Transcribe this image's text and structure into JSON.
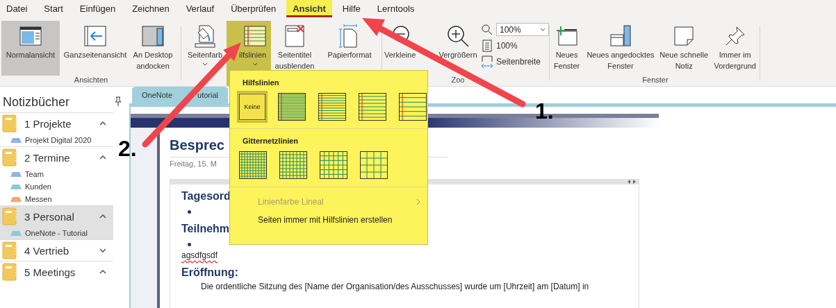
{
  "menu_tabs": [
    {
      "label": "Datei",
      "selected": false
    },
    {
      "label": "Start",
      "selected": false
    },
    {
      "label": "Einfügen",
      "selected": false
    },
    {
      "label": "Zeichnen",
      "selected": false
    },
    {
      "label": "Verlauf",
      "selected": false
    },
    {
      "label": "Überprüfen",
      "selected": false
    },
    {
      "label": "Ansicht",
      "selected": true
    },
    {
      "label": "Hilfe",
      "selected": false
    },
    {
      "label": "Lerntools",
      "selected": false
    }
  ],
  "ribbon_groups": [
    {
      "label": "Ansichten",
      "buttons": [
        {
          "label": "Normalansicht",
          "selected": true,
          "highlighted": false
        },
        {
          "label": "Ganzseitenansicht",
          "selected": false,
          "highlighted": false
        },
        {
          "label": "An Desktop andocken",
          "selected": false,
          "highlighted": false
        }
      ]
    },
    {
      "buttons": [
        {
          "label": "Seitenfarb",
          "caret": true,
          "selected": false,
          "highlighted": false
        },
        {
          "label": "ilfslinien",
          "caret": true,
          "selected": true,
          "highlighted": true
        },
        {
          "label": "Seitentitel ausblenden",
          "selected": false,
          "highlighted": false
        },
        {
          "label": "Papierformat",
          "selected": false,
          "highlighted": false
        }
      ]
    },
    {
      "label": "Zoo",
      "buttons": [
        {
          "label": "Verkleine",
          "selected": false,
          "highlighted": false
        },
        {
          "label": "Vergrößern",
          "selected": false,
          "highlighted": false
        }
      ],
      "small_buttons": [
        {
          "kind": "combo",
          "value": "100%"
        },
        {
          "kind": "button",
          "label": "100%"
        },
        {
          "kind": "button",
          "label": "Seitenbreite"
        }
      ]
    },
    {
      "label": "Fenster",
      "buttons": [
        {
          "label": "Neues Fenster",
          "selected": false,
          "highlighted": false
        },
        {
          "label": "Neues angedocktes Fenster",
          "selected": false,
          "highlighted": false
        },
        {
          "label": "Neue schnelle Notiz",
          "selected": false,
          "highlighted": false
        },
        {
          "label": "Immer im Vordergrund",
          "selected": false,
          "highlighted": false
        }
      ]
    }
  ],
  "sidebar": {
    "title": "Notizbücher",
    "notebooks": [
      {
        "name": "1 Projekte",
        "expanded": true,
        "selected": false,
        "sections": [
          {
            "name": "Projekt Digital 2020",
            "color": "#8fb4e3"
          }
        ]
      },
      {
        "name": "2 Termine",
        "expanded": true,
        "selected": false,
        "sections": [
          {
            "name": "Team",
            "color": "#8fb4e3"
          },
          {
            "name": "Kunden",
            "color": "#8ccad8"
          },
          {
            "name": "Messen",
            "color": "#f0a870"
          }
        ]
      },
      {
        "name": "3 Personal",
        "expanded": true,
        "selected": true,
        "sections": [
          {
            "name": "OneNote - Tutorial",
            "color": "#8ccad8"
          }
        ]
      },
      {
        "name": "4 Vertrieb",
        "expanded": false,
        "selected": false
      },
      {
        "name": "5 Meetings",
        "expanded": true,
        "selected": false
      }
    ]
  },
  "page_tabs": [
    {
      "label": "OneNote",
      "label_tail": "utorial",
      "selected": true
    }
  ],
  "page": {
    "title": "Besprec",
    "date": "Freitag, 15. M",
    "content": [
      {
        "kind": "heading",
        "text": "Tagesord"
      },
      {
        "kind": "bullet"
      },
      {
        "kind": "heading",
        "text": "Teilnehm"
      },
      {
        "kind": "bullet"
      },
      {
        "kind": "text",
        "text": "agsdfgsdf",
        "misspelled": true
      },
      {
        "kind": "heading",
        "text": "Eröffnung:"
      },
      {
        "kind": "paragraph",
        "text": "Die ordentliche Sitzung des [Name der Organisation/des Ausschusses] wurde um [Uhrzeit] am [Datum] in"
      }
    ]
  },
  "dropdown": {
    "sections": [
      {
        "title": "Hilfslinien",
        "options": [
          {
            "kind": "none",
            "label": "Keine",
            "selected": true
          },
          {
            "kind": "ruled",
            "selected": false
          },
          {
            "kind": "ruled",
            "selected": false
          },
          {
            "kind": "ruled",
            "selected": false
          },
          {
            "kind": "ruled",
            "selected": false
          }
        ]
      },
      {
        "title": "Gitternetzlinien",
        "options": [
          {
            "kind": "grid",
            "selected": false
          },
          {
            "kind": "grid",
            "selected": false
          },
          {
            "kind": "grid",
            "selected": false
          },
          {
            "kind": "grid",
            "selected": false
          }
        ]
      }
    ],
    "items": [
      {
        "label": "Linienfarbe Lineal",
        "disabled": true,
        "submenu": true
      },
      {
        "label": "Seiten immer mit Hilfslinien erstellen",
        "disabled": false,
        "submenu": false
      }
    ]
  },
  "annotations": [
    {
      "label": "1."
    },
    {
      "label": "2."
    }
  ]
}
